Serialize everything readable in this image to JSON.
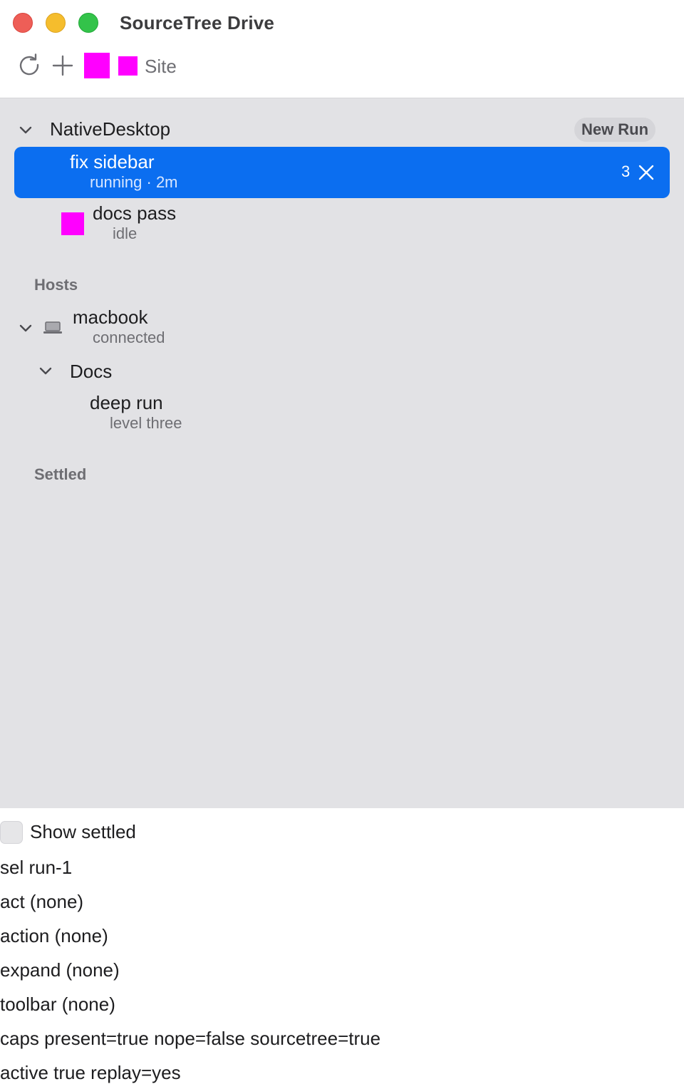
{
  "window": {
    "title": "SourceTree Drive"
  },
  "toolbar": {
    "site_label": "Site",
    "marker_color": "#ff00ff"
  },
  "sidebar": {
    "project": {
      "name": "NativeDesktop",
      "new_run_label": "New Run",
      "runs": [
        {
          "title": "fix sidebar",
          "subtitle": "running · 2m",
          "badge": "3",
          "selected": true
        },
        {
          "title": "docs pass",
          "subtitle": "idle",
          "selected": false
        }
      ]
    },
    "hosts_header": "Hosts",
    "host": {
      "name": "macbook",
      "status": "connected",
      "folder": {
        "name": "Docs",
        "item": {
          "title": "deep run",
          "subtitle": "level three"
        }
      }
    },
    "settled_header": "Settled"
  },
  "footer": {
    "show_settled_label": "Show settled",
    "show_settled_checked": false,
    "lines": [
      "sel run-1",
      "act (none)",
      "action (none)",
      "expand (none)",
      "toolbar (none)",
      "caps present=true nope=false sourcetree=true",
      "active true replay=yes"
    ]
  },
  "colors": {
    "selection": "#0b6ef0",
    "sidebar_bg": "#e2e2e5",
    "marker": "#ff00ff"
  }
}
